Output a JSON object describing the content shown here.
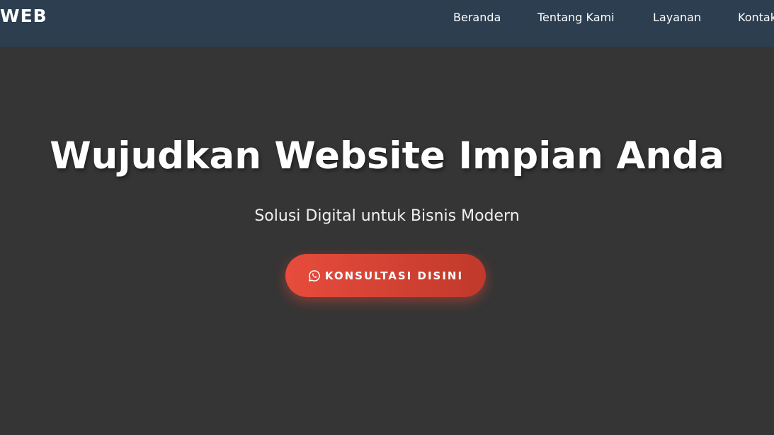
{
  "navbar": {
    "brand": "WEB",
    "links": [
      {
        "label": "Beranda"
      },
      {
        "label": "Tentang Kami"
      },
      {
        "label": "Layanan"
      },
      {
        "label": "Kontak"
      }
    ]
  },
  "hero": {
    "title": "Wujudkan Website Impian Anda",
    "subtitle": "Solusi Digital untuk Bisnis Modern",
    "cta": {
      "label": "KONSULTASI DISINI",
      "icon": "whatsapp-icon"
    }
  },
  "colors": {
    "navbar_bg": "#2c3e50",
    "hero_bg": "#353535",
    "cta_start": "#e74c3c",
    "cta_end": "#c0392b",
    "text": "#ffffff"
  }
}
